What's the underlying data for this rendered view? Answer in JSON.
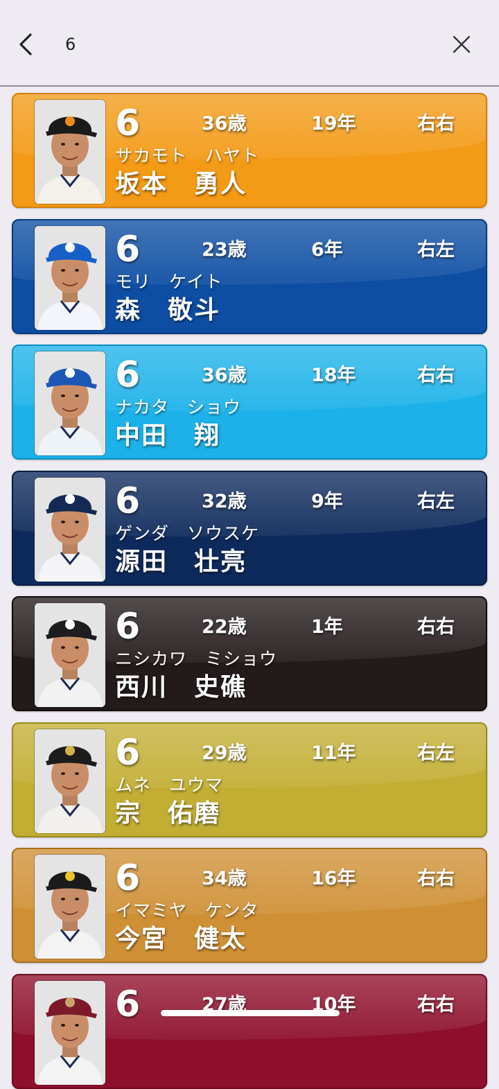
{
  "header": {
    "search_value": "6",
    "back_icon": "chevron-left-icon",
    "clear_icon": "close-icon"
  },
  "players": [
    {
      "number": "6",
      "age": "36歳",
      "years": "19年",
      "hand": "右右",
      "kana": "サカモト　ハヤト",
      "kanji": "坂本　勇人",
      "color": "#f39a16",
      "border": "#d47f06",
      "cap": "#1b1b1b",
      "logo": "#f08a1a",
      "uniform": "#f4f1ea"
    },
    {
      "number": "6",
      "age": "23歳",
      "years": "6年",
      "hand": "右左",
      "kana": "モリ　ケイト",
      "kanji": "森　敬斗",
      "color": "#0d4ea3",
      "border": "#08397c",
      "cap": "#1660c8",
      "logo": "#ffffff",
      "uniform": "#f3f5fa"
    },
    {
      "number": "6",
      "age": "36歳",
      "years": "18年",
      "hand": "右右",
      "kana": "ナカタ　ショウ",
      "kanji": "中田　翔",
      "color": "#1cb2e9",
      "border": "#0d8fc2",
      "cap": "#1e58b6",
      "logo": "#ffffff",
      "uniform": "#eef3f8"
    },
    {
      "number": "6",
      "age": "32歳",
      "years": "9年",
      "hand": "右左",
      "kana": "ゲンダ　ソウスケ",
      "kanji": "源田　壮亮",
      "color": "#0e2a5c",
      "border": "#071c42",
      "cap": "#142a55",
      "logo": "#ffffff",
      "uniform": "#f4f4f6"
    },
    {
      "number": "6",
      "age": "22歳",
      "years": "1年",
      "hand": "右右",
      "kana": "ニシカワ　ミショウ",
      "kanji": "西川　史礁",
      "color": "#231a1a",
      "border": "#120b0b",
      "cap": "#1d1d1f",
      "logo": "#ffffff",
      "uniform": "#f2f2f2"
    },
    {
      "number": "6",
      "age": "29歳",
      "years": "11年",
      "hand": "右左",
      "kana": "ムネ　ユウマ",
      "kanji": "宗　佑磨",
      "color": "#c2ae33",
      "border": "#9c8a1b",
      "cap": "#1c1c1c",
      "logo": "#d2b04a",
      "uniform": "#f1f0ec"
    },
    {
      "number": "6",
      "age": "34歳",
      "years": "16年",
      "hand": "右右",
      "kana": "イマミヤ　ケンタ",
      "kanji": "今宮　健太",
      "color": "#cf9035",
      "border": "#a96e1c",
      "cap": "#1b1b1b",
      "logo": "#e8c42a",
      "uniform": "#f3f3f3"
    },
    {
      "number": "6",
      "age": "27歳",
      "years": "10年",
      "hand": "右右",
      "kana": "",
      "kanji": "",
      "color": "#8e0f2c",
      "border": "#6e0a21",
      "cap": "#7c1a2a",
      "logo": "#c9a46a",
      "uniform": "#f3f3f3"
    }
  ]
}
